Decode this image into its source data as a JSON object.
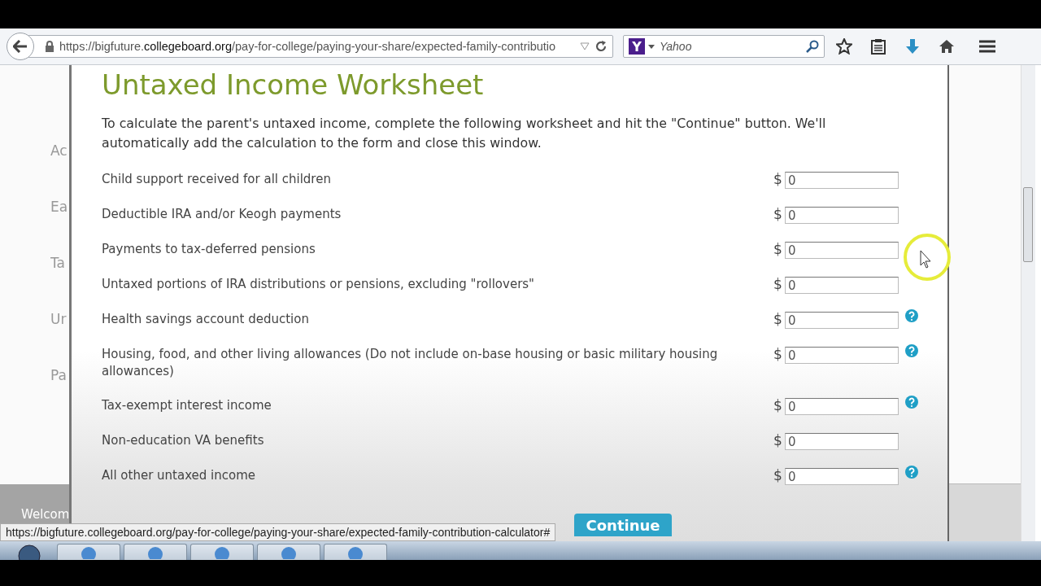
{
  "browser": {
    "url": "https://bigfuture.**collegeboard.org**/pay-for-college/paying-your-share/expected-family-contributio",
    "search": {
      "engine_letter": "Y",
      "placeholder": "Yahoo"
    }
  },
  "background_page": {
    "nav_items": [
      "Ac",
      "Ea",
      "Ta",
      "Ur",
      "Pa"
    ],
    "footer_text": "Welcom"
  },
  "worksheet": {
    "title": "Untaxed Income Worksheet",
    "intro": "To calculate the parent's untaxed income, complete the following worksheet and hit the \"Continue\" button. We'll automatically add the calculation to the form and close this window.",
    "rows": [
      {
        "label": "Child support received for all children",
        "currency": "$",
        "value": "0",
        "help": false
      },
      {
        "label": "Deductible IRA and/or Keogh payments",
        "currency": "$",
        "value": "0",
        "help": false
      },
      {
        "label": "Payments to tax-deferred pensions",
        "currency": "$",
        "value": "0",
        "help": false
      },
      {
        "label": "Untaxed portions of IRA distributions or pensions, excluding \"rollovers\"",
        "currency": "$",
        "value": "0",
        "help": false
      },
      {
        "label": "Health savings account deduction",
        "currency": "$",
        "value": "0",
        "help": true
      },
      {
        "label": "Housing, food, and other living allowances (Do not include on-base housing or basic military housing allowances)",
        "currency": "$",
        "value": "0",
        "help": true
      },
      {
        "label": "Tax-exempt interest income",
        "currency": "$",
        "value": "0",
        "help": true
      },
      {
        "label": "Non-education VA benefits",
        "currency": "$",
        "value": "0",
        "help": false
      },
      {
        "label": "All other untaxed income",
        "currency": "$",
        "value": "0",
        "help": true
      }
    ],
    "continue_button": "Continue"
  },
  "status_url": "https://bigfuture.collegeboard.org/pay-for-college/paying-your-share/expected-family-contribution-calculator#"
}
